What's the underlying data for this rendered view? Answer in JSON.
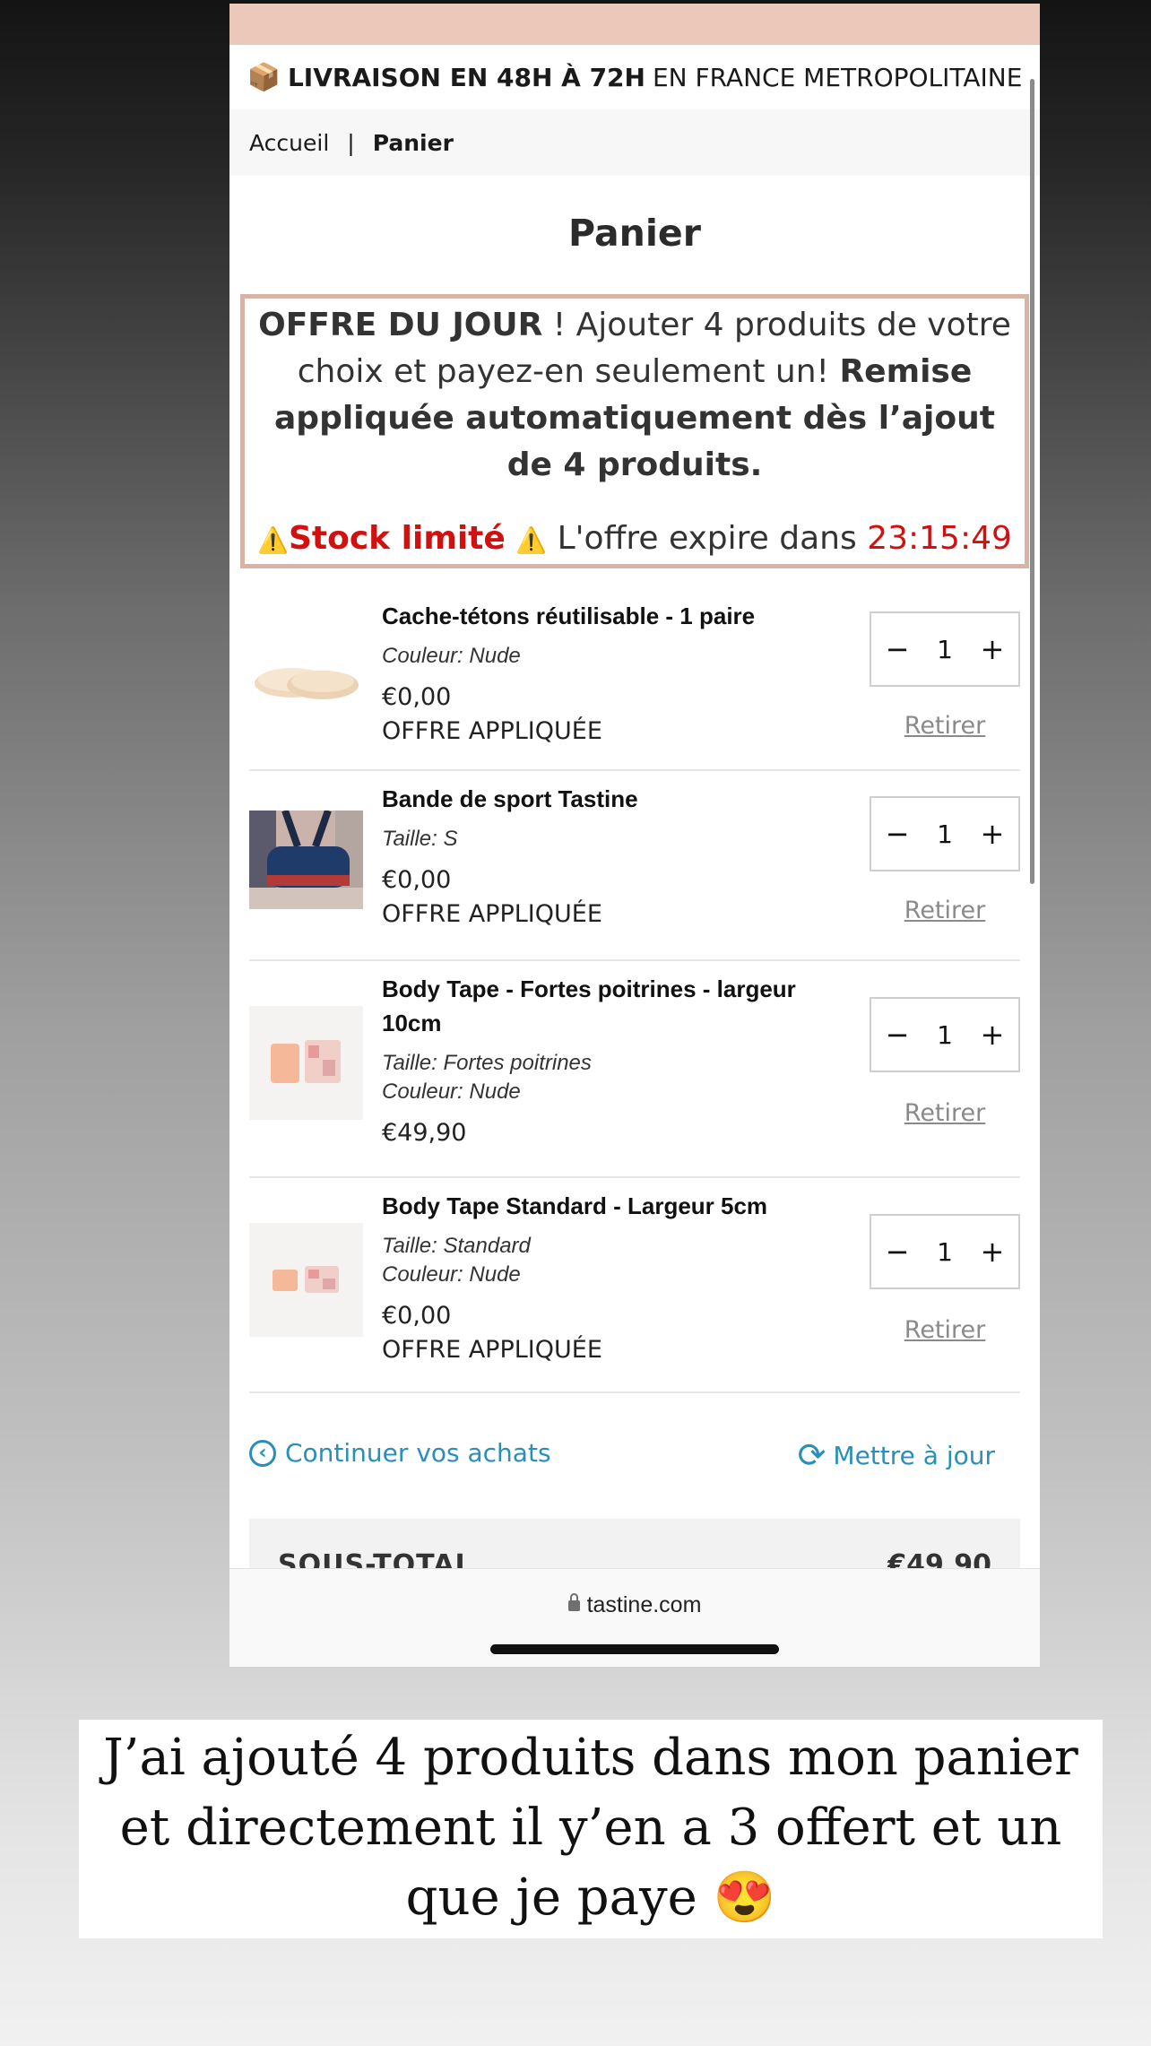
{
  "shipping": {
    "icon": "package-icon",
    "icon_glyph": "📦",
    "bold_text": "LIVRAISON EN 48H À 72H",
    "text": "EN FRANCE METROPOLITAINE"
  },
  "breadcrumb": {
    "home": "Accueil",
    "separator": "|",
    "current": "Panier"
  },
  "page": {
    "title": "Panier"
  },
  "offer": {
    "lead_bold": "OFFRE DU JOUR",
    "lead": " ! Ajouter 4 produits de votre choix et payez-en seulement un! ",
    "tail_bold": "Remise appliquée automatiquement dès l’ajout de 4 produits.",
    "warning_glyph": "⚠️",
    "stock_limited": "Stock limité",
    "expires_label": "L'offre expire dans",
    "timer": "23:15:49"
  },
  "cart": {
    "items": [
      {
        "name": "Cache-tétons réutilisable - 1 paire",
        "variants": [
          "Couleur: Nude"
        ],
        "price": "€0,00",
        "note": "OFFRE APPLIQUÉE",
        "qty": "1",
        "remove": "Retirer"
      },
      {
        "name": "Bande de sport Tastine",
        "variants": [
          "Taille: S"
        ],
        "price": "€0,00",
        "note": "OFFRE APPLIQUÉE",
        "qty": "1",
        "remove": "Retirer"
      },
      {
        "name": "Body Tape - Fortes poitrines - largeur 10cm",
        "variants": [
          "Taille: Fortes poitrines",
          "Couleur: Nude"
        ],
        "price": "€49,90",
        "note": "",
        "qty": "1",
        "remove": "Retirer"
      },
      {
        "name": "Body Tape Standard - Largeur 5cm",
        "variants": [
          "Taille: Standard",
          "Couleur: Nude"
        ],
        "price": "€0,00",
        "note": "OFFRE APPLIQUÉE",
        "qty": "1",
        "remove": "Retirer"
      }
    ],
    "minus": "−",
    "plus": "+"
  },
  "actions": {
    "continue": "Continuer vos achats",
    "update": "Mettre à jour"
  },
  "summary": {
    "subtotal_label": "SOUS-TOTAL",
    "subtotal_value": "€49,90"
  },
  "browser": {
    "url": "tastine.com"
  },
  "caption": {
    "text": "J’ai ajouté 4 produits dans mon panier et directement il y’en a 3 offert et un que je paye",
    "emoji": "😍"
  },
  "colors": {
    "accent": "#2a8fb8",
    "alert": "#d11010",
    "banner": "#ecc8bb",
    "offer_border": "#d9b3a3"
  }
}
